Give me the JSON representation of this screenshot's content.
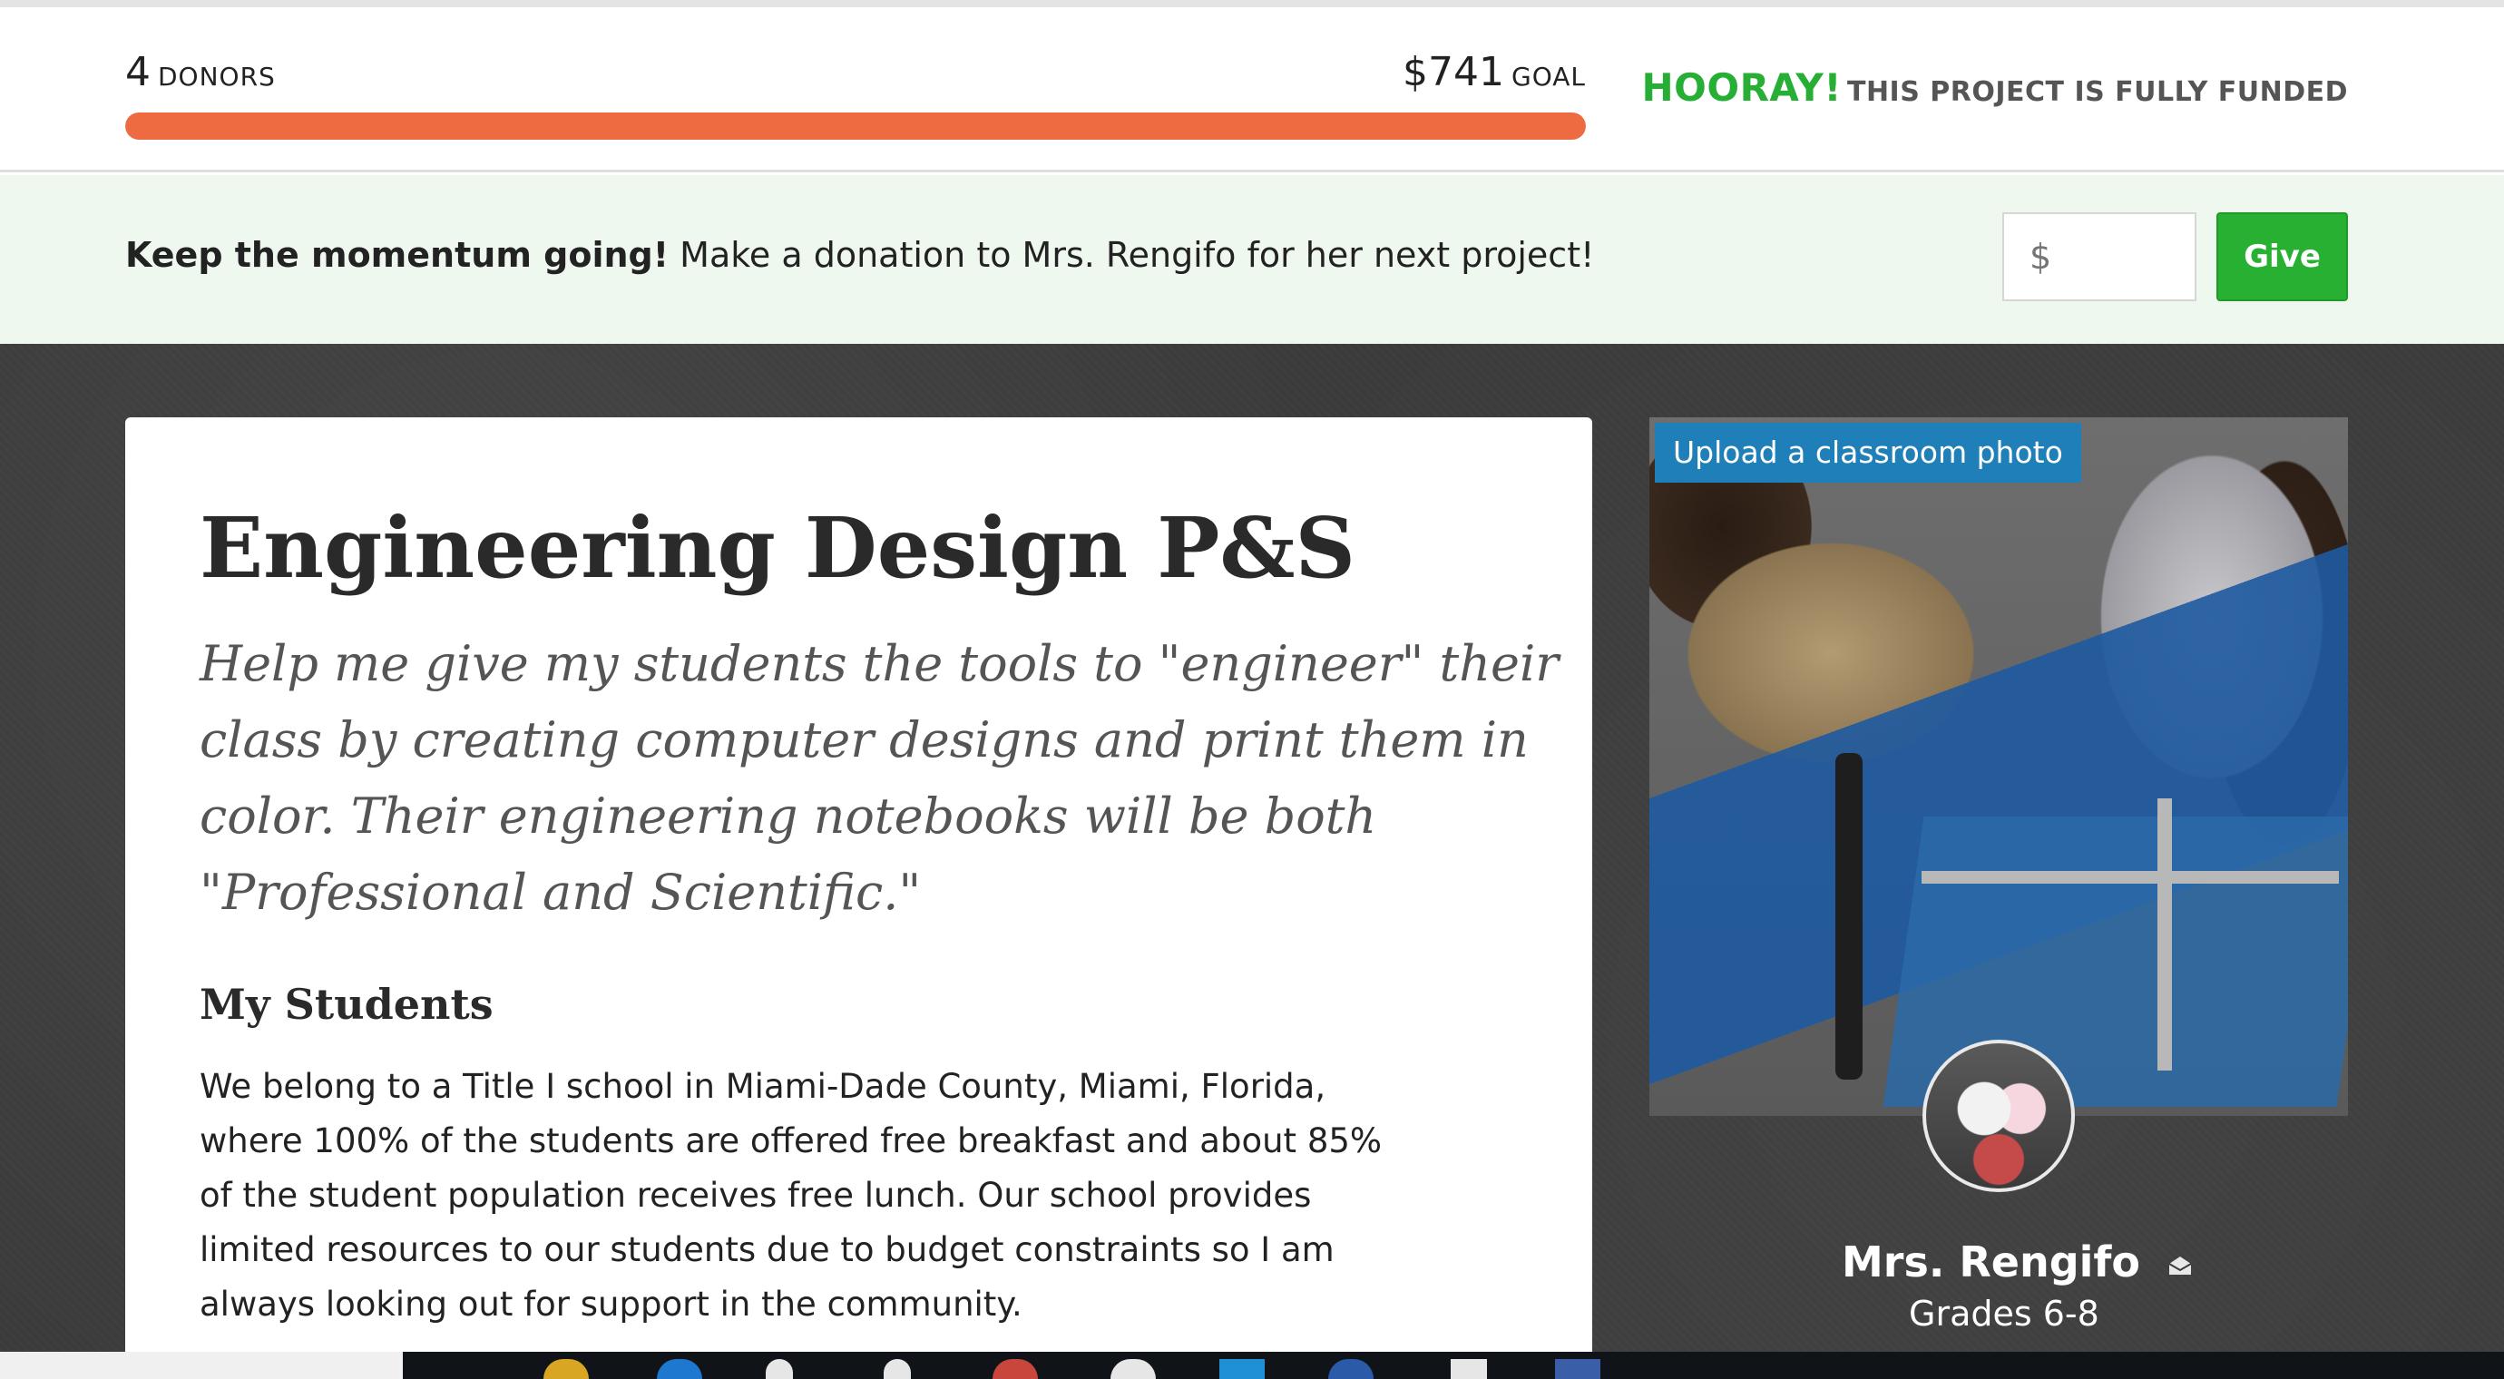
{
  "progress": {
    "donors_count": "4",
    "donors_label": "DONORS",
    "goal_amount": "$741",
    "goal_label": "GOAL",
    "fill_fraction": 1.0,
    "funded_hooray": "HOORAY!",
    "funded_text": "THIS PROJECT IS FULLY FUNDED",
    "bar_color": "#ee6a40"
  },
  "momentum": {
    "bold": "Keep the momentum going!",
    "text": "Make a donation to Mrs. Rengifo for her next project!",
    "amount_placeholder": "$",
    "give_label": "Give"
  },
  "project": {
    "title": "Engineering Design P&S",
    "subtitle": "Help me give my students the tools to \"engineer\" their class by creating computer designs and print them in color. Their engineering notebooks will be both \"Professional and Scientific.\"",
    "section_heading": "My Students",
    "body": "We belong to a Title I school in Miami-Dade County, Miami, Florida, where 100% of the students are offered free breakfast and about 85% of the student population receives free lunch. Our school provides limited resources to our students due to budget constraints so I am always looking out for support in the community."
  },
  "teacher": {
    "upload_label": "Upload a classroom photo",
    "name": "Mrs. Rengifo",
    "grades": "Grades 6-8",
    "mail_icon": "envelope-icon"
  },
  "colors": {
    "accent_green": "#27b032",
    "upload_blue": "#1f7fb8"
  }
}
